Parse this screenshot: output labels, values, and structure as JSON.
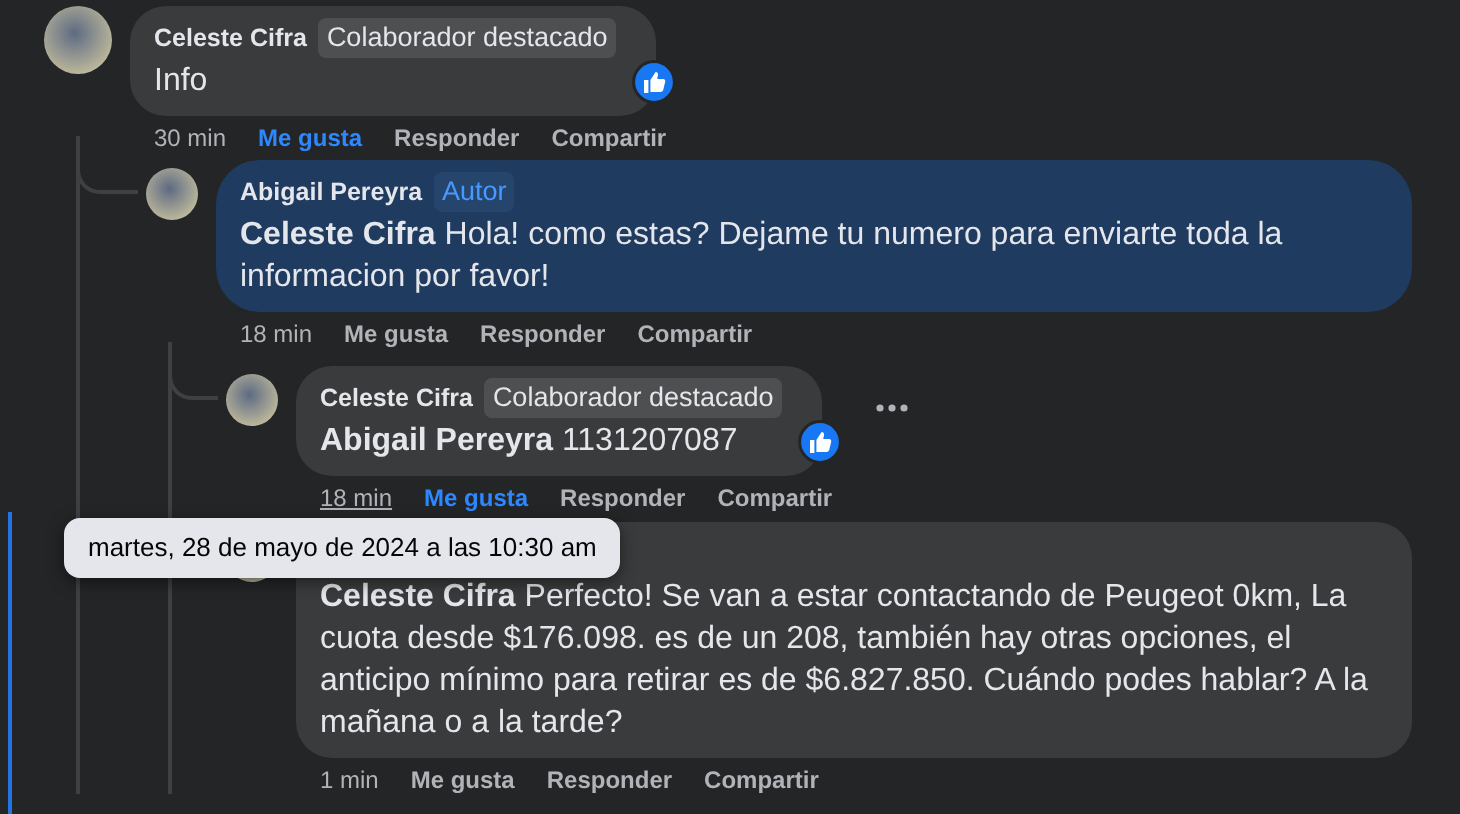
{
  "comments": [
    {
      "author": "Celeste Cifra",
      "badge": {
        "text": "Colaborador destacado",
        "kind": "featured"
      },
      "text": "Info",
      "highlighted": false,
      "liked_reaction": true,
      "time": "30 min",
      "actions": [
        {
          "label": "Me gusta",
          "selected": true
        },
        {
          "label": "Responder",
          "selected": false
        },
        {
          "label": "Compartir",
          "selected": false
        }
      ],
      "children": [
        {
          "author": "Abigail Pereyra",
          "badge": {
            "text": "Autor",
            "kind": "author"
          },
          "mention": "Celeste Cifra",
          "text": "Hola! como estas? Dejame tu numero para enviarte toda la informacion por favor!",
          "highlighted": true,
          "time": "18 min",
          "actions": [
            {
              "label": "Me gusta",
              "selected": false
            },
            {
              "label": "Responder",
              "selected": false
            },
            {
              "label": "Compartir",
              "selected": false
            }
          ],
          "children": [
            {
              "author": "Celeste Cifra",
              "badge": {
                "text": "Colaborador destacado",
                "kind": "featured"
              },
              "mention": "Abigail Pereyra",
              "text": "1131207087",
              "highlighted": false,
              "liked_reaction": true,
              "more_menu": true,
              "time": "18 min",
              "time_underlined": true,
              "actions": [
                {
                  "label": "Me gusta",
                  "selected": true
                },
                {
                  "label": "Responder",
                  "selected": false
                },
                {
                  "label": "Compartir",
                  "selected": false
                }
              ]
            },
            {
              "mention": "Celeste Cifra",
              "text": "Perfecto! Se van a estar contactando de Peugeot 0km, La cuota desde $176.098. es de un 208, también hay otras opciones, el anticipo mínimo para retirar es de $6.827.850. Cuándo podes hablar? A la mañana o a la tarde?",
              "highlighted": false,
              "new": true,
              "time": "1 min",
              "actions": [
                {
                  "label": "Me gusta",
                  "selected": false
                },
                {
                  "label": "Responder",
                  "selected": false
                },
                {
                  "label": "Compartir",
                  "selected": false
                }
              ]
            }
          ]
        }
      ]
    }
  ],
  "tooltip": {
    "text": "martes, 28 de mayo de 2024 a las 10:30 am"
  }
}
